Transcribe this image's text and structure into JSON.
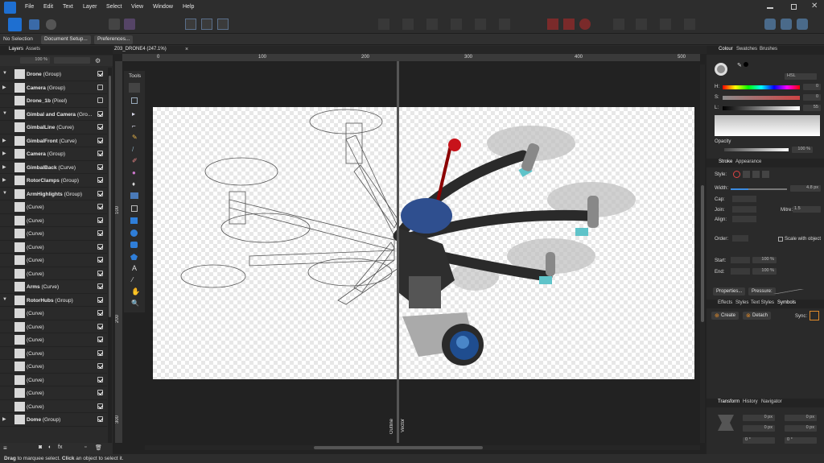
{
  "menu": [
    "File",
    "Edit",
    "Text",
    "Layer",
    "Select",
    "View",
    "Window",
    "Help"
  ],
  "context": {
    "selection": "No Selection",
    "doc_setup": "Document Setup...",
    "prefs": "Preferences..."
  },
  "left_panel": {
    "tabs": [
      "Layers",
      "Assets"
    ],
    "opacity": "100 %",
    "layers": [
      {
        "name": "Drone",
        "kind": "(Group)",
        "bold": true
      },
      {
        "name": "Camera",
        "kind": "(Group)",
        "bold": true
      },
      {
        "name": "Drone_1b",
        "kind": "(Pixel)",
        "bold": true
      },
      {
        "name": "Gimbal and Camera",
        "kind": "(Gro...",
        "bold": true
      },
      {
        "name": "GimbalLine",
        "kind": "(Curve)",
        "bold": true
      },
      {
        "name": "GimbalFront",
        "kind": "(Curve)",
        "bold": true
      },
      {
        "name": "Camera",
        "kind": "(Group)",
        "bold": true
      },
      {
        "name": "GimbalBack",
        "kind": "(Curve)",
        "bold": true
      },
      {
        "name": "RotorClamps",
        "kind": "(Group)",
        "bold": true
      },
      {
        "name": "ArmHighlights",
        "kind": "(Group)",
        "bold": true
      },
      {
        "name": "",
        "kind": "(Curve)",
        "bold": false
      },
      {
        "name": "",
        "kind": "(Curve)",
        "bold": false
      },
      {
        "name": "",
        "kind": "(Curve)",
        "bold": false
      },
      {
        "name": "",
        "kind": "(Curve)",
        "bold": false
      },
      {
        "name": "",
        "kind": "(Curve)",
        "bold": false
      },
      {
        "name": "",
        "kind": "(Curve)",
        "bold": false
      },
      {
        "name": "Arms",
        "kind": "(Curve)",
        "bold": true
      },
      {
        "name": "RotorHubs",
        "kind": "(Group)",
        "bold": true
      },
      {
        "name": "",
        "kind": "(Curve)",
        "bold": false
      },
      {
        "name": "",
        "kind": "(Curve)",
        "bold": false
      },
      {
        "name": "",
        "kind": "(Curve)",
        "bold": false
      },
      {
        "name": "",
        "kind": "(Curve)",
        "bold": false
      },
      {
        "name": "",
        "kind": "(Curve)",
        "bold": false
      },
      {
        "name": "",
        "kind": "(Curve)",
        "bold": false
      },
      {
        "name": "",
        "kind": "(Curve)",
        "bold": false
      },
      {
        "name": "",
        "kind": "(Curve)",
        "bold": false
      },
      {
        "name": "Dome",
        "kind": "(Group)",
        "bold": true
      }
    ]
  },
  "document": {
    "tab": "Z03_DRONE4 (247.1%)",
    "tools_label": "Tools",
    "ruler_h": [
      "0",
      "100",
      "200",
      "300",
      "400",
      "500"
    ],
    "ruler_v": [
      "100",
      "200",
      "300"
    ],
    "split_left": "Outline",
    "split_right": "Vector"
  },
  "right_panel": {
    "color_tabs": [
      "Colour",
      "Swatches",
      "Brushes"
    ],
    "color_mode": "HSL",
    "h": "0",
    "s": "0",
    "l": "55",
    "opacity_label": "Opacity",
    "opacity_value": "100 %",
    "stroke_tabs": [
      "Stroke",
      "Appearance"
    ],
    "style_label": "Style:",
    "width_label": "Width:",
    "width_value": "4.8 px",
    "cap_label": "Cap:",
    "join_label": "Join:",
    "mitre_label": "Mitre:",
    "mitre_value": "1.5",
    "align_label": "Align:",
    "order_label": "Order:",
    "scale_label": "Scale with object",
    "start_label": "Start:",
    "end_label": "End:",
    "start_pct": "100 %",
    "end_pct": "100 %",
    "properties_btn": "Properties...",
    "pressure_btn": "Pressure:",
    "fx_tabs": [
      "Effects",
      "Styles",
      "Text Styles",
      "Symbols"
    ],
    "create_btn": "Create",
    "detach_btn": "Detach",
    "sync_label": "Sync:",
    "transform_tabs": [
      "Transform",
      "History",
      "Navigator"
    ],
    "tf": {
      "x": "0 px",
      "y": "0 px",
      "w": "0 px",
      "h": "0 px",
      "r": "0 °",
      "s": "0 °"
    }
  },
  "status": {
    "bold1": "Drag",
    "t1": " to marquee select. ",
    "bold2": "Click",
    "t2": " an object to select it."
  },
  "colors": {
    "accent": "#1e6fd1",
    "arm_band": "#5fc3c9",
    "red_ball": "#c8131b",
    "dome": "#2f4f8f",
    "lens": "#1f4d8f"
  }
}
